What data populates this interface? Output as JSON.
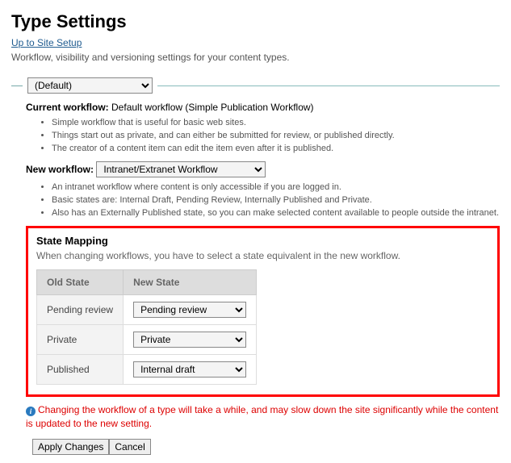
{
  "title": "Type Settings",
  "uplink": "Up to Site Setup",
  "subtitle": "Workflow, visibility and versioning settings for your content types.",
  "type_select": "(Default)",
  "current_workflow_label": "Current workflow:",
  "current_workflow_value": "Default workflow (Simple Publication Workflow)",
  "current_bullets": [
    "Simple workflow that is useful for basic web sites.",
    "Things start out as private, and can either be submitted for review, or published directly.",
    "The creator of a content item can edit the item even after it is published."
  ],
  "new_workflow_label": "New workflow:",
  "new_workflow_value": "Intranet/Extranet Workflow",
  "new_bullets": [
    "An intranet workflow where content is only accessible if you are logged in.",
    "Basic states are: Internal Draft, Pending Review, Internally Published and Private.",
    "Also has an Externally Published state, so you can make selected content available to people outside the intranet."
  ],
  "state_mapping": {
    "heading": "State Mapping",
    "desc": "When changing workflows, you have to select a state equivalent in the new workflow.",
    "col_old": "Old State",
    "col_new": "New State",
    "rows": [
      {
        "old": "Pending review",
        "new": "Pending review"
      },
      {
        "old": "Private",
        "new": "Private"
      },
      {
        "old": "Published",
        "new": "Internal draft"
      }
    ]
  },
  "warning": "Changing the workflow of a type will take a while, and may slow down the site significantly while the content is updated to the new setting.",
  "buttons": {
    "apply": "Apply Changes",
    "cancel": "Cancel"
  }
}
